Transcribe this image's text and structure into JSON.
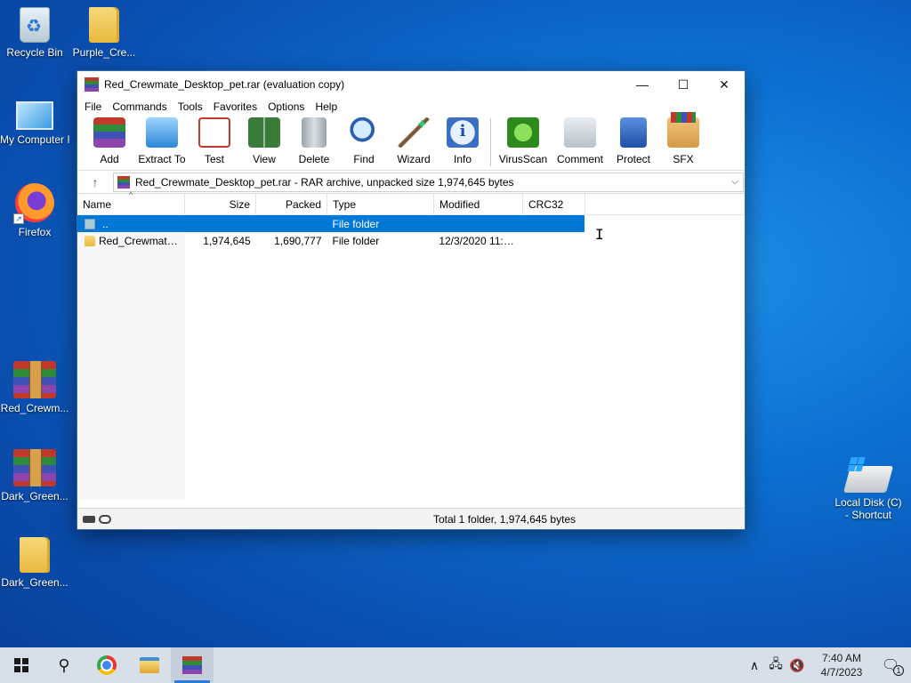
{
  "desktop": {
    "icons": [
      {
        "label": "Recycle Bin"
      },
      {
        "label": "Purple_Cre..."
      },
      {
        "label": "My Computer R"
      },
      {
        "label": "Firefox"
      },
      {
        "label": "Red_Crewm..."
      },
      {
        "label": "Dark_Green..."
      },
      {
        "label": "Dark_Green..."
      },
      {
        "label": "Local Disk (C)",
        "label2": "- Shortcut"
      }
    ]
  },
  "window": {
    "title": "Red_Crewmate_Desktop_pet.rar (evaluation copy)",
    "controls": {
      "minimize": "—",
      "maximize": "☐",
      "close": "✕"
    },
    "menu": [
      "File",
      "Commands",
      "Tools",
      "Favorites",
      "Options",
      "Help"
    ],
    "toolbar": [
      {
        "label": "Add",
        "icon": "add-archive-icon"
      },
      {
        "label": "Extract To",
        "icon": "extract-folder-icon"
      },
      {
        "label": "Test",
        "icon": "test-checklist-icon"
      },
      {
        "label": "View",
        "icon": "view-book-icon"
      },
      {
        "label": "Delete",
        "icon": "trash-icon"
      },
      {
        "label": "Find",
        "icon": "magnifier-icon"
      },
      {
        "label": "Wizard",
        "icon": "magic-wand-icon"
      },
      {
        "label": "Info",
        "icon": "info-icon"
      },
      {
        "label": "VirusScan",
        "icon": "virus-icon"
      },
      {
        "label": "Comment",
        "icon": "comment-icon"
      },
      {
        "label": "Protect",
        "icon": "shield-icon"
      },
      {
        "label": "SFX",
        "icon": "sfx-box-icon"
      }
    ],
    "address": {
      "up_glyph": "↑",
      "text": "Red_Crewmate_Desktop_pet.rar - RAR archive, unpacked size 1,974,645 bytes",
      "dropdown_glyph": "⌵"
    },
    "columns": [
      "Name",
      "Size",
      "Packed",
      "Type",
      "Modified",
      "CRC32"
    ],
    "rows": [
      {
        "name": "..",
        "size": "",
        "packed": "",
        "type": "File folder",
        "modified": "",
        "crc": "",
        "selected": true
      },
      {
        "name": "Red_Crewmate_...",
        "size": "1,974,645",
        "packed": "1,690,777",
        "type": "File folder",
        "modified": "12/3/2020 11:5...",
        "crc": "",
        "selected": false
      }
    ],
    "status": "Total 1 folder, 1,974,645 bytes"
  },
  "taskbar": {
    "search_glyph": "⚲",
    "tray": {
      "chevron": "∧",
      "network": "🖧",
      "volume": "🔇",
      "time": "7:40 AM",
      "date": "4/7/2023",
      "notifications": "🗨",
      "badge": "1"
    }
  },
  "colors": {
    "selection": "#0078d7",
    "desktop": "#0c6fd0",
    "taskbar": "#d7dfe9"
  }
}
